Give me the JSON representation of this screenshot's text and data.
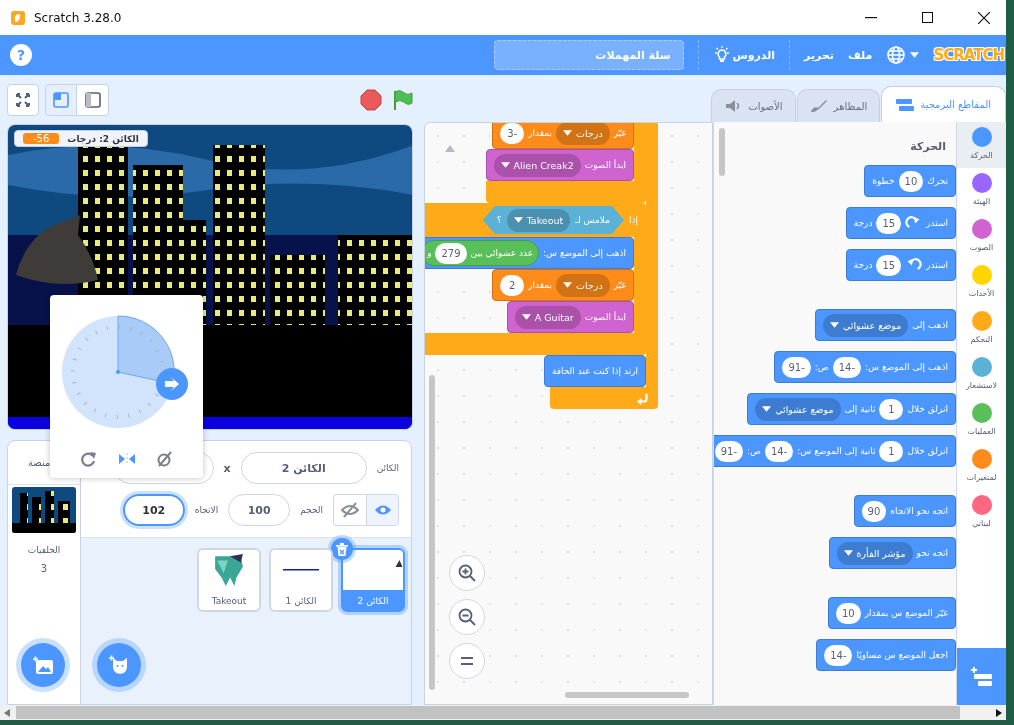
{
  "window": {
    "title": "Scratch 3.28.0"
  },
  "menu_bar": {
    "logo": "SCRATCH",
    "menus": [
      "ملف",
      "تحرير"
    ],
    "tutorials": "الدروس",
    "project_title": "سلة المهملات",
    "help": "?"
  },
  "stage_size_modes": [
    {
      "kind": "small",
      "selected": true
    },
    {
      "kind": "large",
      "selected": false
    }
  ],
  "tabs": [
    {
      "kind": "code",
      "label": "المقاطع البرمجية",
      "selected": true
    },
    {
      "kind": "costumes",
      "label": "المظاهر",
      "selected": false
    },
    {
      "kind": "sounds",
      "label": "الأصوات",
      "selected": false
    }
  ],
  "stage": {
    "monitor": {
      "label": "الكائن 2: درجات",
      "value": "-56"
    }
  },
  "direction_popover": {
    "modes": [
      {
        "kind": "all-around",
        "selected": false
      },
      {
        "kind": "left-right",
        "selected": true
      },
      {
        "kind": "dont-rotate",
        "selected": false
      }
    ]
  },
  "sprite_info": {
    "name_label": "الكائن",
    "name": "الكائن 2",
    "x_label": "x",
    "visible": true,
    "size_label": "الحجم",
    "size": "100",
    "direction_label": "الاتجاه",
    "direction": "102"
  },
  "sprites": [
    {
      "kind": "bag",
      "name": "الكائن 2",
      "selected": true
    },
    {
      "kind": "line",
      "name": "الكائن 1",
      "selected": false
    },
    {
      "kind": "figure",
      "name": "Takeout",
      "selected": false
    }
  ],
  "stage_panel": {
    "title": "منصة",
    "backdrops_label": "الخلفيات",
    "backdrop_count": "3"
  },
  "scripts": [
    {
      "kind": "forever",
      "color": "#ffab19",
      "inner": [
        {
          "kind": "c",
          "color": "#ffab19",
          "inner": [
            {
              "kind": "stack",
              "color": "#ff8c1a",
              "parts": [
                {
                  "kind": "label",
                  "text": "غيّر"
                },
                {
                  "kind": "menu",
                  "text": "درجات"
                },
                {
                  "kind": "label",
                  "text": "بمقدار"
                },
                {
                  "kind": "num",
                  "text": "-3"
                }
              ]
            },
            {
              "kind": "stack",
              "color": "#cf63cf",
              "parts": [
                {
                  "kind": "label",
                  "text": "ابدأ الصوت"
                },
                {
                  "kind": "menu",
                  "text": "Alien Creak2"
                }
              ]
            }
          ]
        },
        {
          "kind": "c",
          "color": "#ffab19",
          "parts": [
            {
              "kind": "label",
              "text": "إذا"
            },
            {
              "kind": "boolean",
              "color": "#5cb1d6",
              "parts": [
                {
                  "kind": "label",
                  "text": "ملامس لـ"
                },
                {
                  "kind": "menu",
                  "text": "Takeout"
                },
                {
                  "kind": "label",
                  "text": "؟"
                }
              ]
            }
          ],
          "inner": [
            {
              "kind": "stack",
              "color": "#4c97ff",
              "parts": [
                {
                  "kind": "label",
                  "text": "اذهب إلى الموضع س:"
                },
                {
                  "kind": "reporter",
                  "color": "#59c059",
                  "parts": [
                    {
                      "kind": "label",
                      "text": "عدد عشوائي بين"
                    },
                    {
                      "kind": "num",
                      "text": "279"
                    },
                    {
                      "kind": "label",
                      "text": "و"
                    }
                  ]
                }
              ]
            },
            {
              "kind": "stack",
              "color": "#ff8c1a",
              "parts": [
                {
                  "kind": "label",
                  "text": "غيّر"
                },
                {
                  "kind": "menu",
                  "text": "درجات"
                },
                {
                  "kind": "label",
                  "text": "بمقدار"
                },
                {
                  "kind": "num",
                  "text": "2"
                }
              ]
            },
            {
              "kind": "stack",
              "color": "#cf63cf",
              "parts": [
                {
                  "kind": "label",
                  "text": "ابدأ الصوت"
                },
                {
                  "kind": "menu",
                  "text": "A Guitar"
                }
              ]
            }
          ]
        },
        {
          "kind": "stack",
          "color": "#4c97ff",
          "parts": [
            {
              "kind": "label",
              "text": "ارتد إذا كنت عند الحافة"
            }
          ]
        }
      ]
    }
  ],
  "palette": {
    "heading": "الحركة",
    "groups": [
      [
        {
          "kind": "stack",
          "color": "#4c97ff",
          "parts": [
            {
              "kind": "label",
              "text": "تحرك"
            },
            {
              "kind": "num",
              "text": "10"
            },
            {
              "kind": "label",
              "text": "خطوة"
            }
          ]
        },
        {
          "kind": "stack",
          "color": "#4c97ff",
          "parts": [
            {
              "kind": "label",
              "text": "استدر"
            },
            {
              "kind": "turn-cw"
            },
            {
              "kind": "num",
              "text": "15"
            },
            {
              "kind": "label",
              "text": "درجة"
            }
          ]
        },
        {
          "kind": "stack",
          "color": "#4c97ff",
          "parts": [
            {
              "kind": "label",
              "text": "استدر"
            },
            {
              "kind": "turn-ccw"
            },
            {
              "kind": "num",
              "text": "15"
            },
            {
              "kind": "label",
              "text": "درجة"
            }
          ]
        }
      ],
      [
        {
          "kind": "stack",
          "color": "#4c97ff",
          "parts": [
            {
              "kind": "label",
              "text": "اذهب إلى"
            },
            {
              "kind": "menu",
              "text": "موضع عشوائي"
            }
          ]
        },
        {
          "kind": "stack",
          "color": "#4c97ff",
          "parts": [
            {
              "kind": "label",
              "text": "اذهب إلى الموضع س:"
            },
            {
              "kind": "num",
              "text": "-14"
            },
            {
              "kind": "label",
              "text": "ص:"
            },
            {
              "kind": "num",
              "text": "-91"
            }
          ]
        },
        {
          "kind": "stack",
          "color": "#4c97ff",
          "parts": [
            {
              "kind": "label",
              "text": "انزلق خلال"
            },
            {
              "kind": "num",
              "text": "1"
            },
            {
              "kind": "label",
              "text": "ثانية إلى"
            },
            {
              "kind": "menu",
              "text": "موضع عشوائي"
            }
          ]
        },
        {
          "kind": "stack",
          "color": "#4c97ff",
          "parts": [
            {
              "kind": "label",
              "text": "انزلق خلال"
            },
            {
              "kind": "num",
              "text": "1"
            },
            {
              "kind": "label",
              "text": "ثانية إلى الموضع س:"
            },
            {
              "kind": "num",
              "text": "-14"
            },
            {
              "kind": "label",
              "text": "ص:"
            },
            {
              "kind": "num",
              "text": "-91"
            }
          ]
        }
      ],
      [
        {
          "kind": "stack",
          "color": "#4c97ff",
          "parts": [
            {
              "kind": "label",
              "text": "اتجه نحو الاتجاه"
            },
            {
              "kind": "num",
              "text": "90"
            }
          ]
        },
        {
          "kind": "stack",
          "color": "#4c97ff",
          "parts": [
            {
              "kind": "label",
              "text": "اتجه نحو"
            },
            {
              "kind": "menu",
              "text": "مؤشر الفأرة"
            }
          ]
        }
      ],
      [
        {
          "kind": "stack",
          "color": "#4c97ff",
          "parts": [
            {
              "kind": "label",
              "text": "غيّر الموضع س بمقدار"
            },
            {
              "kind": "num",
              "text": "10"
            }
          ]
        },
        {
          "kind": "stack",
          "color": "#4c97ff",
          "parts": [
            {
              "kind": "label",
              "text": "اجعل الموضع س مساويًا"
            },
            {
              "kind": "num",
              "text": "-14"
            }
          ]
        }
      ]
    ]
  },
  "categories": [
    {
      "name": "الحركة",
      "color": "#4c97ff",
      "selected": true
    },
    {
      "name": "الهيئة",
      "color": "#9966ff",
      "selected": false
    },
    {
      "name": "الصوت",
      "color": "#cf63cf",
      "selected": false
    },
    {
      "name": "الأحداث",
      "color": "#ffd500",
      "selected": false
    },
    {
      "name": "التحكم",
      "color": "#ffab19",
      "selected": false
    },
    {
      "name": "لاستشعار",
      "color": "#5cb1d6",
      "selected": false
    },
    {
      "name": "العمليات",
      "color": "#59c059",
      "selected": false
    },
    {
      "name": "لمتغيرات",
      "color": "#ff8c1a",
      "selected": false
    },
    {
      "name": "لبناتي",
      "color": "#ff6680",
      "selected": false
    }
  ]
}
